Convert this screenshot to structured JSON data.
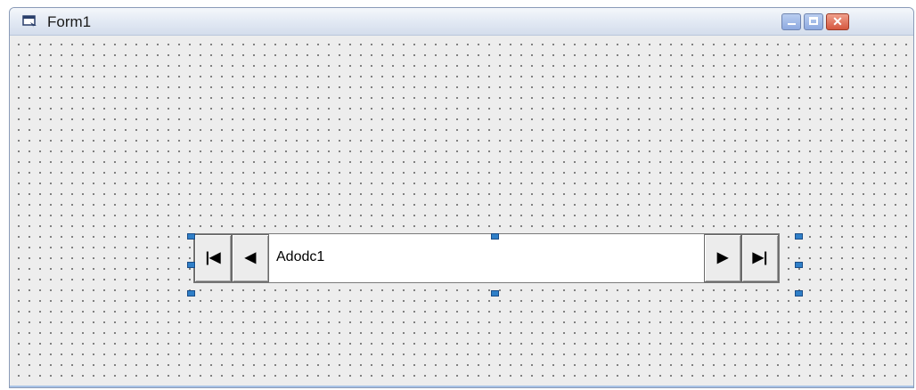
{
  "window": {
    "title": "Form1",
    "controls": {
      "minimize_icon": "minimize-icon",
      "maximize_icon": "maximize-icon",
      "close_icon": "close-icon"
    }
  },
  "form": {
    "background_color": "#ededed",
    "grid_dot_color": "#6b6b6b"
  },
  "adodc": {
    "caption": "Adodc1",
    "buttons": {
      "first": {
        "icon": "first-record-icon",
        "glyph": "|◀"
      },
      "previous": {
        "icon": "previous-record-icon",
        "glyph": "◀"
      },
      "next": {
        "icon": "next-record-icon",
        "glyph": "▶"
      },
      "last": {
        "icon": "last-record-icon",
        "glyph": "▶|"
      }
    },
    "selection_handle_color": "#2f7fc8"
  }
}
